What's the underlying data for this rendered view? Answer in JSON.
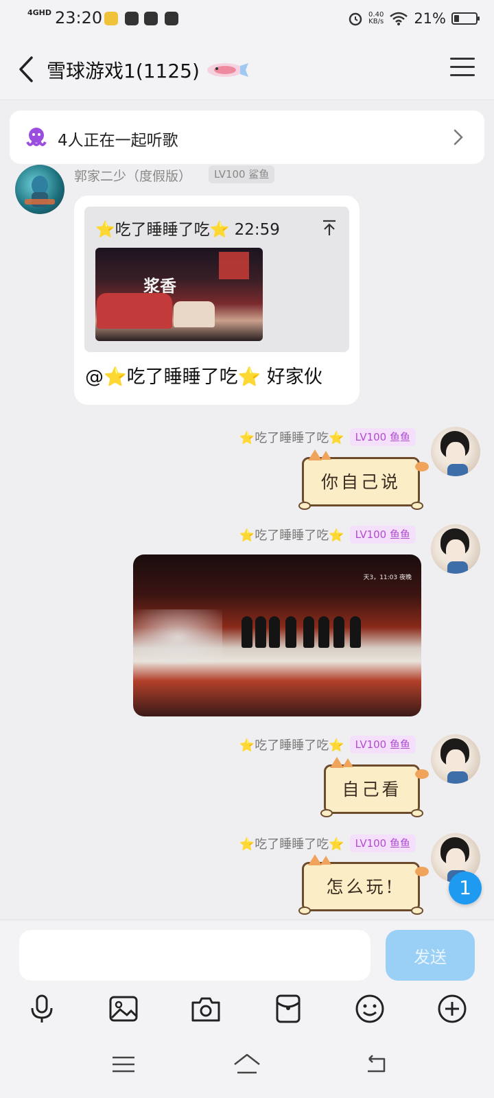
{
  "status_bar": {
    "network": "4GHD",
    "time": "23:20",
    "speed_value": "0.40",
    "speed_unit": "KB/s",
    "battery": "21%"
  },
  "header": {
    "title": "雪球游戏1(1125)"
  },
  "listen_banner": {
    "text": "4人正在一起听歌"
  },
  "messages": {
    "first": {
      "sender": "郭家二少（度假版）",
      "level": "LV100 鲨鱼",
      "quote_header": "⭐吃了睡睡了吃⭐ 22:59",
      "reply_text": "@⭐吃了睡睡了吃⭐ 好家伙",
      "thumb_sign": "浆香"
    },
    "m2": {
      "sender": "⭐吃了睡睡了吃⭐",
      "level": "LV100 鱼鱼",
      "text": "你自己说"
    },
    "m3": {
      "sender": "⭐吃了睡睡了吃⭐",
      "level": "LV100 鱼鱼",
      "image_hud": "天3，11:03 夜晚"
    },
    "m4": {
      "sender": "⭐吃了睡睡了吃⭐",
      "level": "LV100 鱼鱼",
      "text": "自己看"
    },
    "m5": {
      "sender": "⭐吃了睡睡了吃⭐",
      "level": "LV100 鱼鱼",
      "text": "怎么玩!"
    }
  },
  "unread_count": "1",
  "input": {
    "value": "",
    "send_label": "发送"
  },
  "toolbar": {
    "icons": [
      "microphone-icon",
      "image-icon",
      "camera-icon",
      "red-packet-icon",
      "emoji-icon",
      "plus-icon"
    ]
  },
  "navbar": {
    "icons": [
      "menu-nav-icon",
      "home-nav-icon",
      "back-nav-icon"
    ]
  },
  "colors": {
    "accent_blue": "#1e9af0",
    "send_button": "#9ad0f6",
    "level_pink_bg": "#f4e0fa",
    "level_pink_text": "#b04ccf",
    "cat_bubble": "#fbeec7"
  }
}
